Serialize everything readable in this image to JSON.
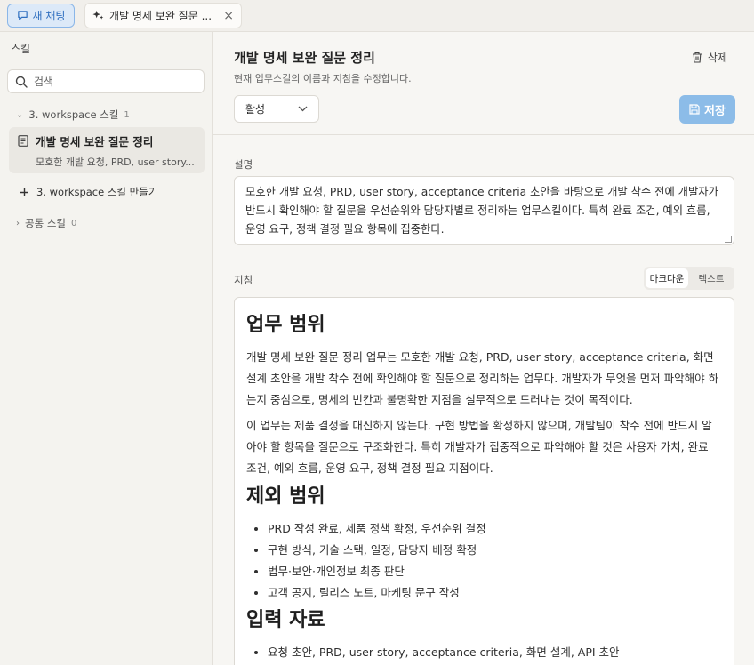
{
  "topbar": {
    "new_chat_label": "새 채팅",
    "tab_label": "개발 명세 보완 질문 ...",
    "tab_close": "×"
  },
  "sidebar": {
    "title": "스킬",
    "search_placeholder": "검색",
    "workspace_group": {
      "label": "3. workspace 스킬",
      "count": "1"
    },
    "selected_skill": {
      "title": "개발 명세 보완 질문 정리",
      "subtitle": "모호한 개발 요청, PRD, user story..."
    },
    "add_skill_label": "3. workspace 스킬 만들기",
    "shared_group": {
      "label": "공통 스킬",
      "count": "0"
    }
  },
  "header": {
    "title": "개발 명세 보완 질문 정리",
    "subtitle": "현재 업무스킬의 이름과 지침을 수정합니다.",
    "delete_label": "삭제",
    "status_value": "활성",
    "save_label": "저장"
  },
  "description": {
    "label": "설명",
    "text": "모호한 개발 요청, PRD, user story, acceptance criteria 초안을 바탕으로 개발 착수 전에 개발자가 반드시 확인해야 할 질문을 우선순위와 담당자별로 정리하는 업무스킬이다. 특히 완료 조건, 예외 흐름, 운영 요구, 정책 결정 필요 항목에 집중한다."
  },
  "instructions": {
    "label": "지침",
    "mode_markdown": "마크다운",
    "mode_text": "텍스트",
    "sections": [
      {
        "heading": "업무 범위"
      },
      {
        "heading": "제외 범위"
      },
      {
        "heading": "입력 자료"
      }
    ],
    "scope_paragraphs": [
      "개발 명세 보완 질문 정리 업무는 모호한 개발 요청, PRD, user story, acceptance criteria, 화면 설계 초안을 개발 착수 전에 확인해야 할 질문으로 정리하는 업무다. 개발자가 무엇을 먼저 파악해야 하는지 중심으로, 명세의 빈칸과 불명확한 지점을 실무적으로 드러내는 것이 목적이다.",
      "이 업무는 제품 결정을 대신하지 않는다. 구현 방법을 확정하지 않으며, 개발팀이 착수 전에 반드시 알아야 할 항목을 질문으로 구조화한다. 특히 개발자가 집중적으로 파악해야 할 것은 사용자 가치, 완료 조건, 예외 흐름, 운영 요구, 정책 결정 필요 지점이다."
    ],
    "excluded_items": [
      "PRD 작성 완료, 제품 정책 확정, 우선순위 결정",
      "구현 방식, 기술 스택, 일정, 담당자 배정 확정",
      "법무·보안·개인정보 최종 판단",
      "고객 공지, 릴리스 노트, 마케팅 문구 작성"
    ],
    "input_items": [
      "요청 초안, PRD, user story, acceptance criteria, 화면 설계, API 초안"
    ]
  }
}
